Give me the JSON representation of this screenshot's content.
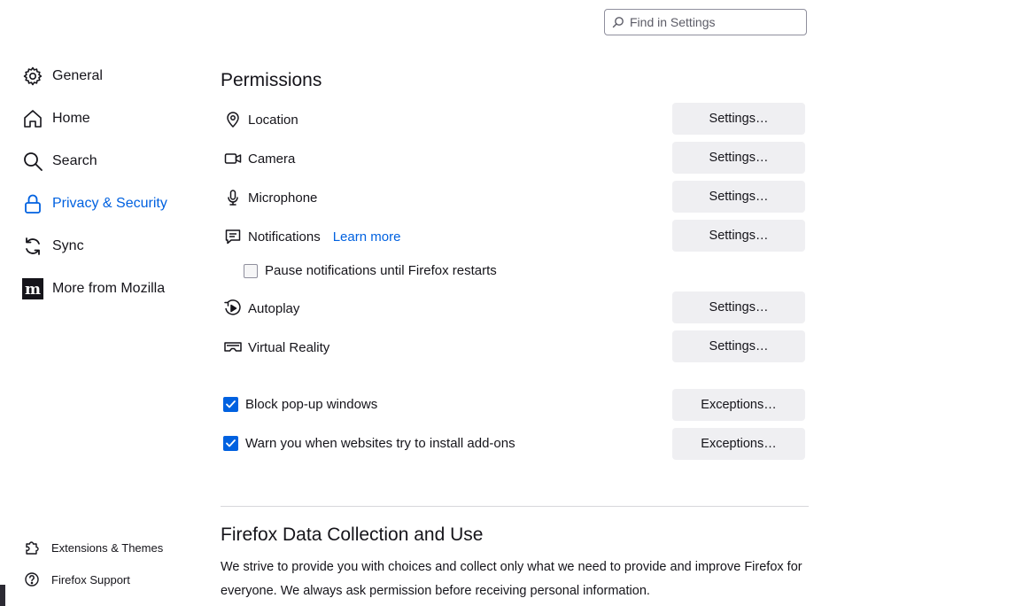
{
  "search": {
    "placeholder": "Find in Settings"
  },
  "sidebar": {
    "items": [
      {
        "label": "General",
        "icon": "gear-icon"
      },
      {
        "label": "Home",
        "icon": "home-icon"
      },
      {
        "label": "Search",
        "icon": "search-icon"
      },
      {
        "label": "Privacy & Security",
        "icon": "lock-icon",
        "active": true
      },
      {
        "label": "Sync",
        "icon": "sync-icon"
      },
      {
        "label": "More from Mozilla",
        "icon": "mozilla-icon"
      }
    ],
    "footer": [
      {
        "label": "Extensions & Themes",
        "icon": "puzzle-icon"
      },
      {
        "label": "Firefox Support",
        "icon": "help-icon"
      }
    ]
  },
  "permissions": {
    "title": "Permissions",
    "rows": [
      {
        "label": "Location",
        "icon": "location-icon",
        "button": "Settings…"
      },
      {
        "label": "Camera",
        "icon": "camera-icon",
        "button": "Settings…"
      },
      {
        "label": "Microphone",
        "icon": "microphone-icon",
        "button": "Settings…"
      },
      {
        "label": "Notifications",
        "icon": "notification-icon",
        "button": "Settings…",
        "link": "Learn more"
      },
      {
        "label": "Autoplay",
        "icon": "autoplay-icon",
        "button": "Settings…"
      },
      {
        "label": "Virtual Reality",
        "icon": "vr-icon",
        "button": "Settings…"
      }
    ],
    "pause_notifications": {
      "label": "Pause notifications until Firefox restarts",
      "checked": false
    },
    "block_popups": {
      "label": "Block pop-up windows",
      "checked": true,
      "button": "Exceptions…"
    },
    "warn_addons": {
      "label": "Warn you when websites try to install add-ons",
      "checked": true,
      "button": "Exceptions…"
    }
  },
  "data_collection": {
    "title": "Firefox Data Collection and Use",
    "description": "We strive to provide you with choices and collect only what we need to provide and improve Firefox for everyone. We always ask permission before receiving personal information."
  },
  "colors": {
    "accent": "#0061e0",
    "button_bg": "#efeff2",
    "text": "#15141a"
  }
}
